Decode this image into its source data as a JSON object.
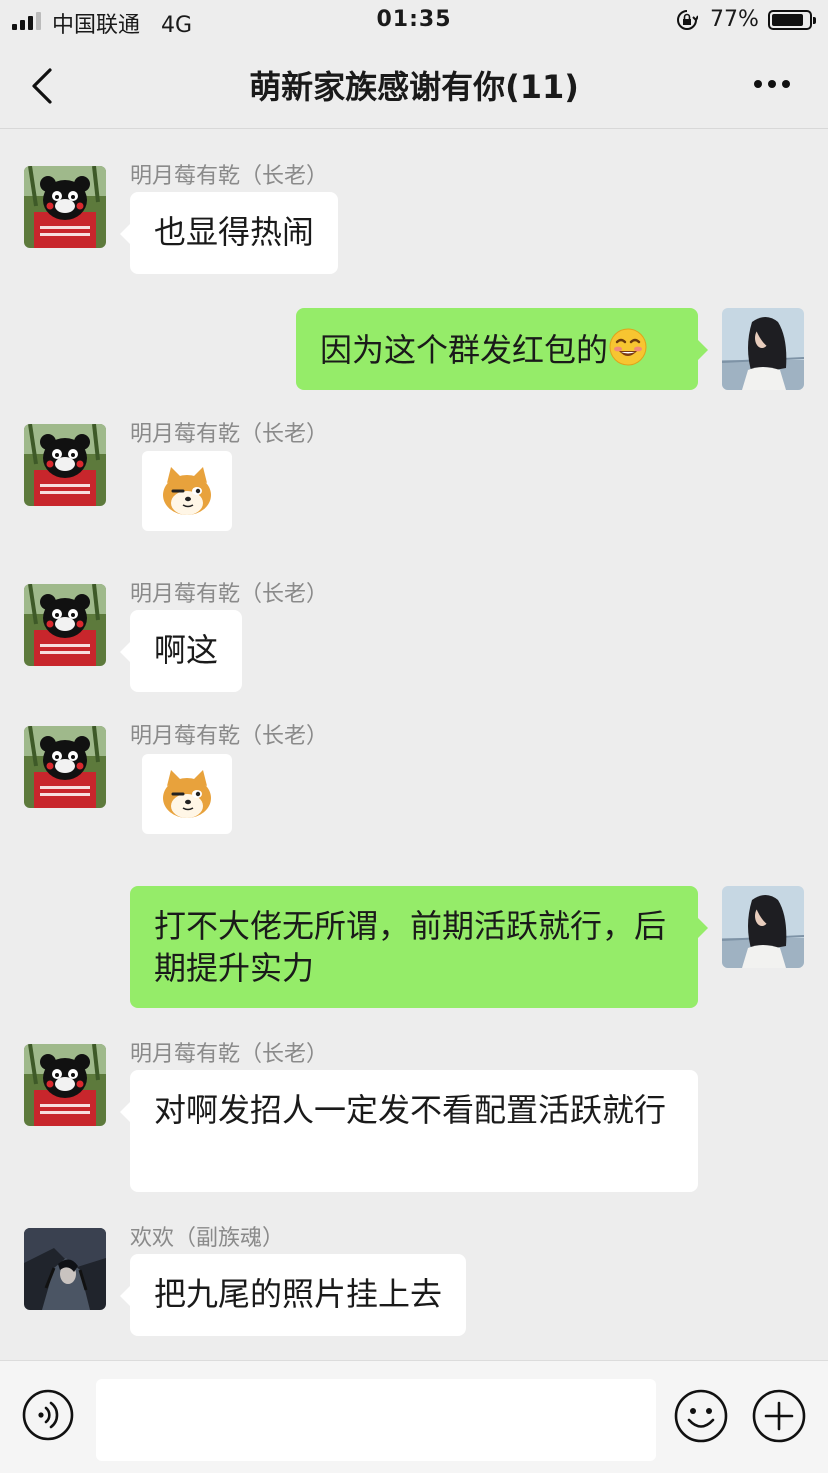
{
  "status_bar": {
    "carrier": "中国联通",
    "network": "4G",
    "time": "01:35",
    "battery_percent": "77%"
  },
  "nav": {
    "title": "萌新家族感谢有你(11)"
  },
  "messages": [
    {
      "side": "left",
      "sender": "明月莓有乾（长老）",
      "text": "也显得热闹",
      "avatar": "kumamon-avatar"
    },
    {
      "side": "right",
      "text": "因为这个群发红包的",
      "emoji": "grinning-face-emoji",
      "avatar": "girl-avatar"
    },
    {
      "side": "left",
      "sender": "明月莓有乾（长老）",
      "sticker": "shiba-dog-sticker",
      "avatar": "kumamon-avatar"
    },
    {
      "side": "left",
      "sender": "明月莓有乾（长老）",
      "text": "啊这",
      "avatar": "kumamon-avatar"
    },
    {
      "side": "left",
      "sender": "明月莓有乾（长老）",
      "sticker": "shiba-dog-sticker",
      "avatar": "kumamon-avatar"
    },
    {
      "side": "right",
      "text": "打不大佬无所谓，前期活跃就行，后期提升实力",
      "avatar": "girl-avatar"
    },
    {
      "side": "left",
      "sender": "明月莓有乾（长老）",
      "text": "对啊发招人一定发不看配置活跃就行",
      "avatar": "kumamon-avatar"
    },
    {
      "side": "left",
      "sender": "欢欢（副族魂）",
      "text": "把九尾的照片挂上去",
      "avatar": "anime-avatar"
    }
  ],
  "colors": {
    "background": "#ededed",
    "bubble_self": "#95ec69",
    "bubble_other": "#ffffff",
    "sender_name": "#8a8a8a"
  },
  "input_bar": {
    "icons": [
      "voice-icon",
      "emoji-icon",
      "plus-icon"
    ]
  }
}
